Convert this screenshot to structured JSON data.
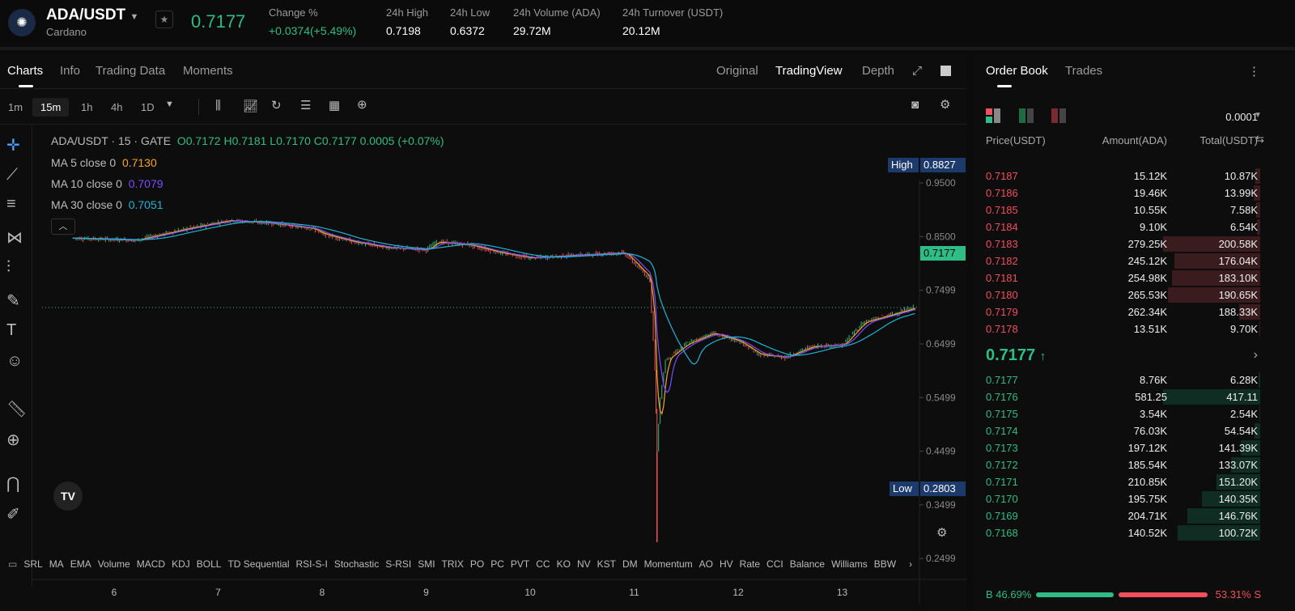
{
  "header": {
    "pair": "ADA/USDT",
    "name": "Cardano",
    "last_price": "0.7177",
    "stats": [
      {
        "label": "Change %",
        "value": "+0.0374(+5.49%)"
      },
      {
        "label": "24h High",
        "value": "0.7198"
      },
      {
        "label": "24h Low",
        "value": "0.6372"
      },
      {
        "label": "24h Volume (ADA)",
        "value": "29.72M"
      },
      {
        "label": "24h Turnover (USDT)",
        "value": "20.12M"
      }
    ]
  },
  "tabs": [
    "Charts",
    "Info",
    "Trading Data",
    "Moments"
  ],
  "views": [
    "Original",
    "TradingView",
    "Depth"
  ],
  "timeframes": [
    "1m",
    "15m",
    "1h",
    "4h",
    "1D"
  ],
  "legend": {
    "title": "ADA/USDT · 15 · GATE",
    "o": "O0.7172",
    "h": "H0.7181",
    "l": "L0.7170",
    "c": "C0.7177",
    "chg": "0.0005 (+0.07%)",
    "ma5_label": "MA 5 close 0",
    "ma5": "0.7130",
    "ma10_label": "MA 10 close 0",
    "ma10": "0.7079",
    "ma30_label": "MA 30 close 0",
    "ma30": "0.7051"
  },
  "markers": {
    "high_label": "High",
    "high": "0.8827",
    "low_label": "Low",
    "low": "0.2803",
    "current": "0.7177"
  },
  "indicators": [
    "SRL",
    "MA",
    "EMA",
    "Volume",
    "MACD",
    "KDJ",
    "BOLL",
    "TD Sequential",
    "RSI-S-I",
    "Stochastic",
    "S-RSI",
    "SMI",
    "TRIX",
    "PO",
    "PC",
    "PVT",
    "CC",
    "KO",
    "NV",
    "KST",
    "DM",
    "Momentum",
    "AO",
    "HV",
    "Rate",
    "CCI",
    "Balance",
    "Williams",
    "BBW"
  ],
  "chart_data": {
    "type": "line",
    "title": "ADA/USDT · 15 · GATE",
    "x_ticks": [
      "6",
      "7",
      "8",
      "9",
      "10",
      "11",
      "12",
      "13"
    ],
    "y_ticks": [
      "0.9500",
      "0.8500",
      "0.7499",
      "0.6499",
      "0.5499",
      "0.4499",
      "0.3499",
      "0.2499"
    ],
    "ylim": [
      0.2499,
      0.95
    ],
    "xlim": [
      5.6,
      13.95
    ],
    "series": [
      {
        "name": "price",
        "x": [
          5.6,
          6.2,
          6.7,
          7.1,
          7.5,
          7.9,
          8.0,
          8.3,
          8.6,
          9.0,
          9.1,
          9.4,
          9.7,
          10.0,
          10.4,
          10.9,
          11.0,
          11.15,
          11.2,
          11.22,
          11.25,
          11.3,
          11.5,
          11.75,
          12.0,
          12.2,
          12.45,
          12.7,
          13.0,
          13.2,
          13.6,
          13.7
        ],
        "y": [
          0.847,
          0.843,
          0.865,
          0.88,
          0.875,
          0.865,
          0.855,
          0.84,
          0.83,
          0.825,
          0.84,
          0.835,
          0.82,
          0.81,
          0.815,
          0.82,
          0.8,
          0.77,
          0.6,
          0.45,
          0.55,
          0.62,
          0.65,
          0.67,
          0.655,
          0.63,
          0.625,
          0.645,
          0.648,
          0.69,
          0.712,
          0.7177
        ]
      }
    ],
    "low_wick": {
      "x": 11.22,
      "y": 0.2803
    },
    "color_up": "#2fbd85",
    "color_down": "#f0505a"
  },
  "orderbook": {
    "tabs": [
      "Order Book",
      "Trades"
    ],
    "precision": "0.0001",
    "headers": [
      "Price(USDT)",
      "Amount(ADA)",
      "Total(USDT)"
    ],
    "asks": [
      [
        "0.7187",
        "15.12K",
        "10.87K",
        0.05
      ],
      [
        "0.7186",
        "19.46K",
        "13.99K",
        0.07
      ],
      [
        "0.7185",
        "10.55K",
        "7.58K",
        0.04
      ],
      [
        "0.7184",
        "9.10K",
        "6.54K",
        0.03
      ],
      [
        "0.7183",
        "279.25K",
        "200.58K",
        1.0
      ],
      [
        "0.7182",
        "245.12K",
        "176.04K",
        0.88
      ],
      [
        "0.7181",
        "254.98K",
        "183.10K",
        0.91
      ],
      [
        "0.7180",
        "265.53K",
        "190.65K",
        0.95
      ],
      [
        "0.7179",
        "262.34K",
        "188.33K",
        0.22
      ],
      [
        "0.7178",
        "13.51K",
        "9.70K",
        0.01
      ]
    ],
    "mid": "0.7177",
    "bids": [
      [
        "0.7177",
        "8.76K",
        "6.28K",
        0.02
      ],
      [
        "0.7176",
        "581.25",
        "417.11",
        1.0
      ],
      [
        "0.7175",
        "3.54K",
        "2.54K",
        0.01
      ],
      [
        "0.7174",
        "76.03K",
        "54.54K",
        0.06
      ],
      [
        "0.7173",
        "197.12K",
        "141.39K",
        0.2
      ],
      [
        "0.7172",
        "185.54K",
        "133.07K",
        0.3
      ],
      [
        "0.7171",
        "210.85K",
        "151.20K",
        0.45
      ],
      [
        "0.7170",
        "195.75K",
        "140.35K",
        0.6
      ],
      [
        "0.7169",
        "204.71K",
        "146.76K",
        0.75
      ],
      [
        "0.7168",
        "140.52K",
        "100.72K",
        0.85
      ]
    ],
    "buy_pct": "B 46.69%",
    "sell_pct": "53.31% S",
    "buy_ratio": 0.4669
  }
}
